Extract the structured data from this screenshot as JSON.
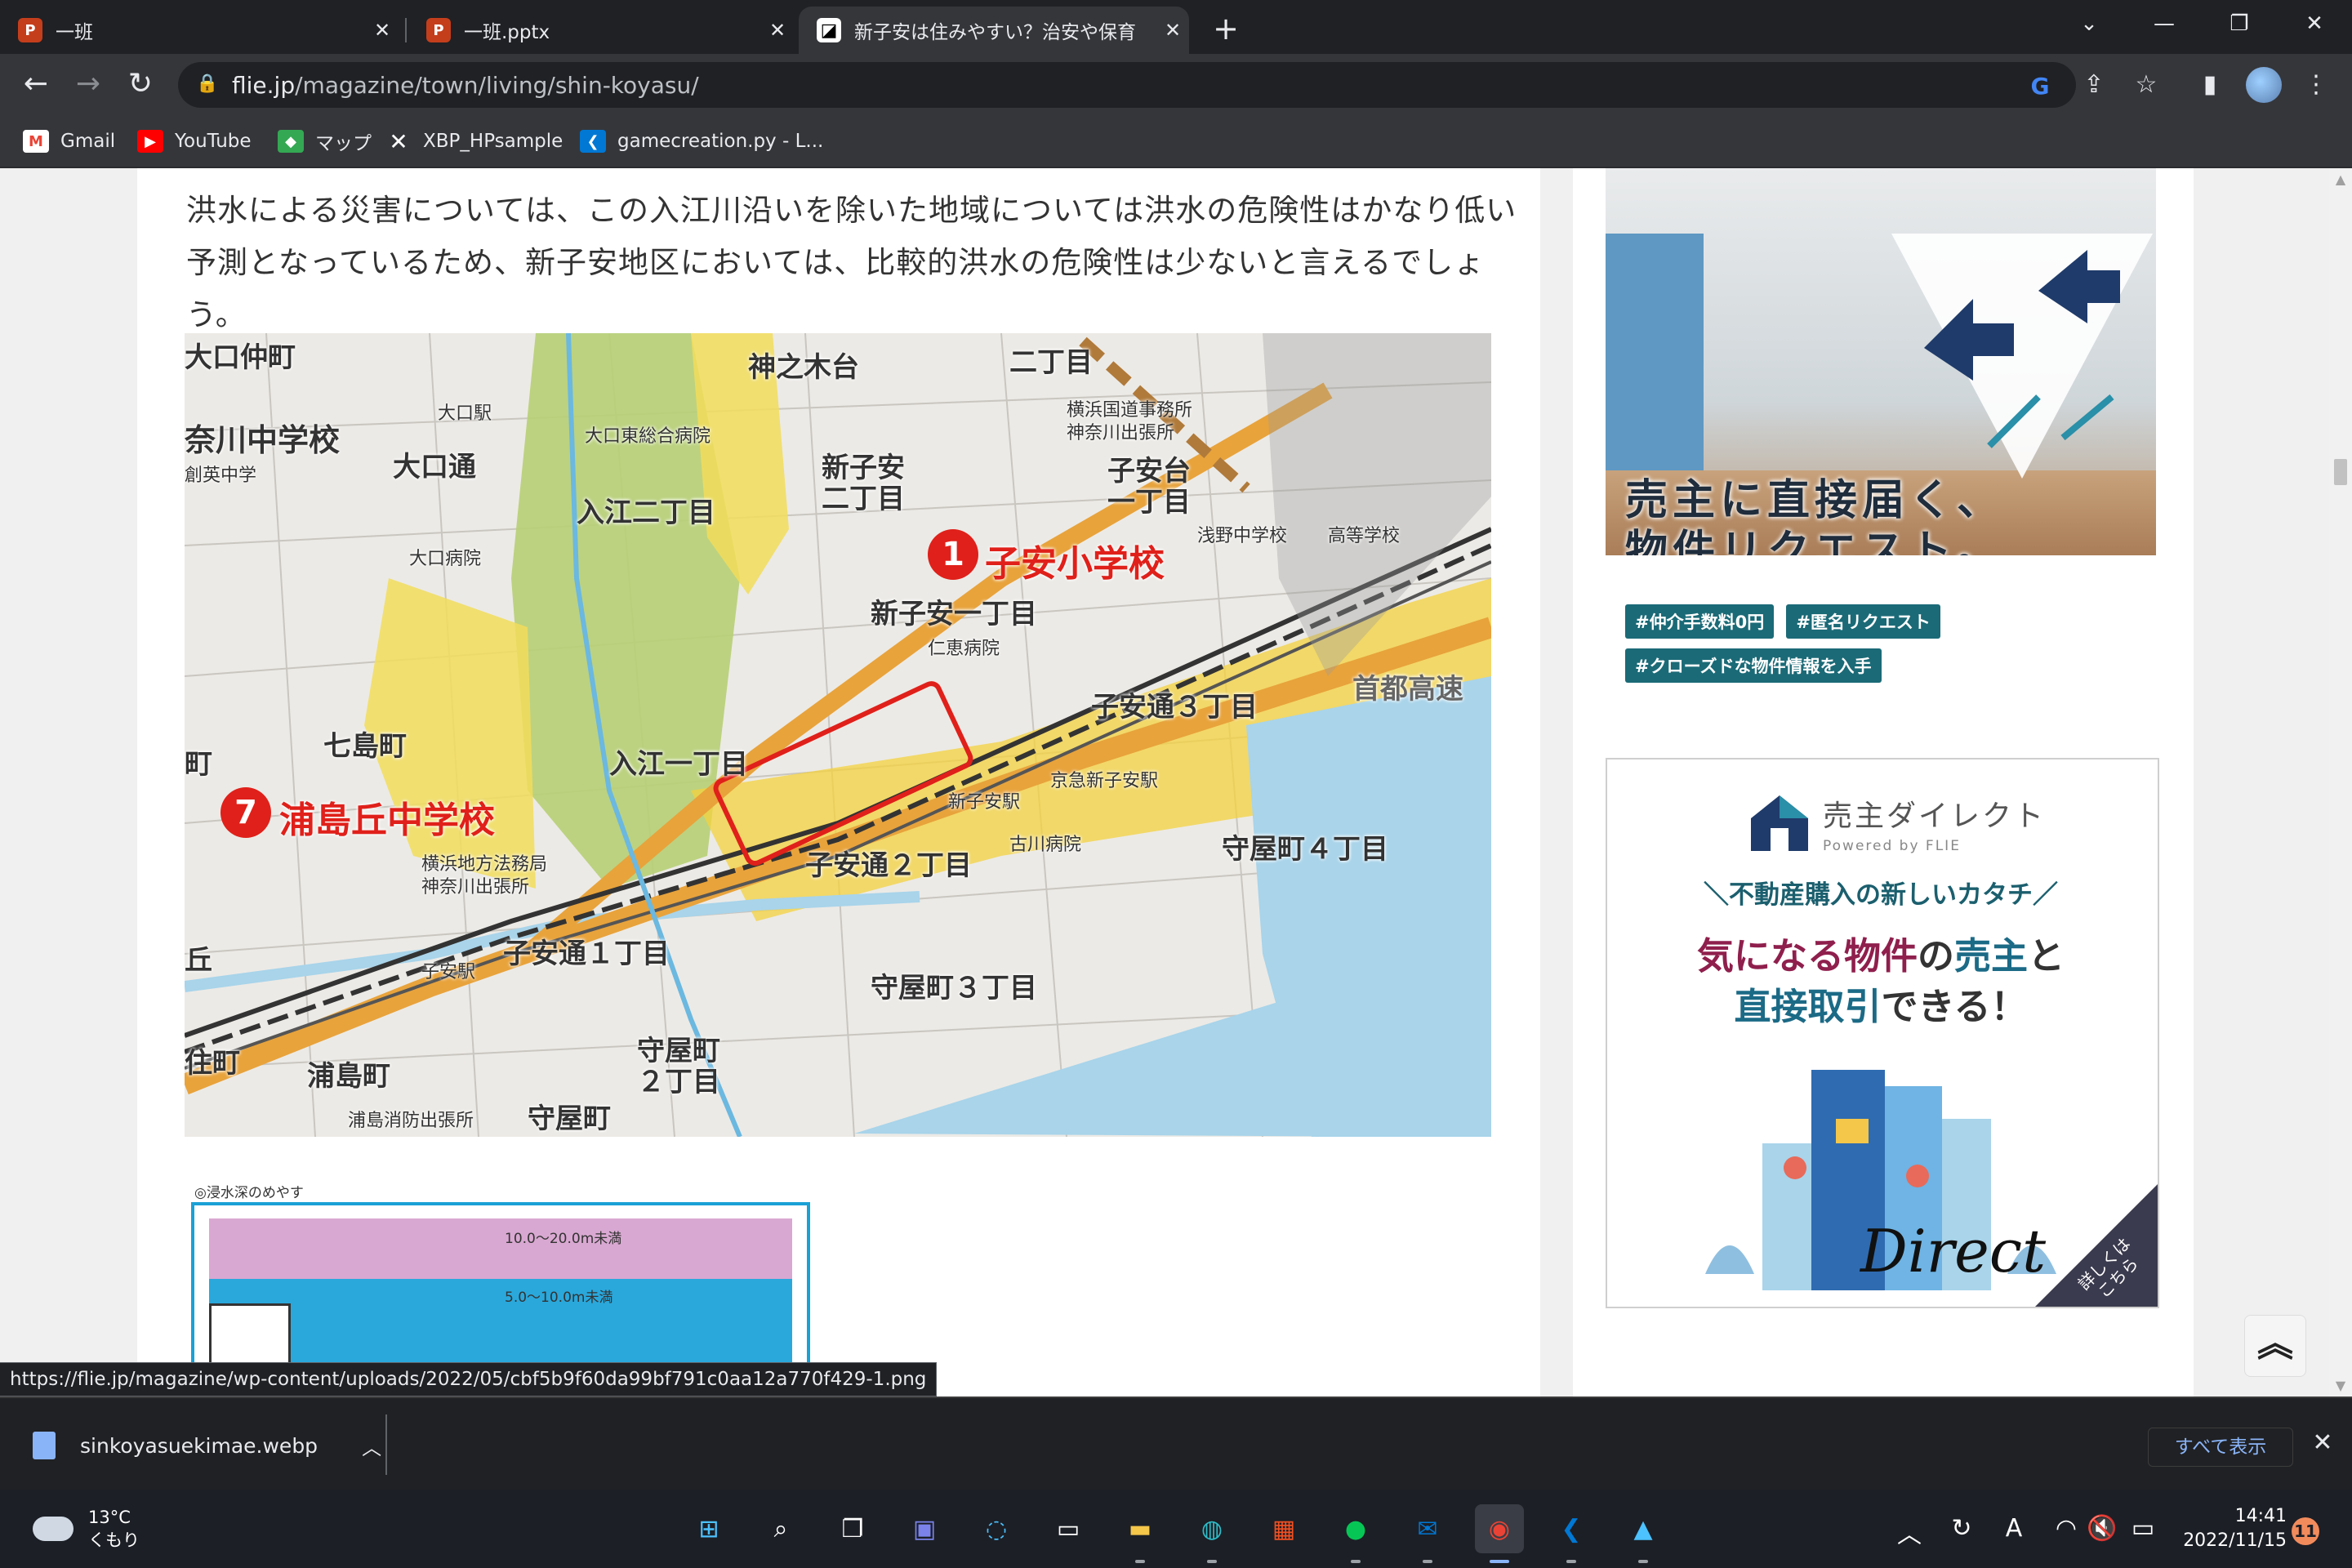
{
  "tabs": [
    {
      "title": "一班",
      "icon": "powerpoint-icon"
    },
    {
      "title": "一班.pptx",
      "icon": "powerpoint-icon"
    },
    {
      "title": "新子安は住みやすい？治安や保育",
      "icon": "flie-site-icon",
      "active": true
    }
  ],
  "omnibox": {
    "domain": "flie.jp",
    "path": "/magazine/town/living/shin-koyasu/"
  },
  "bookmarks": [
    {
      "label": "Gmail",
      "icon": "gmail-icon"
    },
    {
      "label": "YouTube",
      "icon": "youtube-icon"
    },
    {
      "label": "マップ",
      "icon": "maps-icon"
    },
    {
      "label": "XBP_HPsample",
      "icon": "x-icon"
    },
    {
      "label": "gamecreation.py - L...",
      "icon": "vscode-icon"
    }
  ],
  "article": {
    "paragraph": "洪水による災害については、この入江川沿いを除いた地域については洪水の危険性はかなり低い予測となっているため、新子安地区においては、比較的洪水の危険性は少ないと言えるでしょう。",
    "map_labels": {
      "oguchi_nakamachi": "大口仲町",
      "kaminoki": "神之木台",
      "nichome": "二丁目",
      "nagawa_school": "奈川中学校",
      "oguchi_station": "大口駅",
      "oguchi_dori": "大口通",
      "oguchi_hospital_east": "大口東総合病院",
      "soei": "創英中学",
      "irie_2": "入江二丁目",
      "shinkoyasu_2": "新子安二丁目",
      "koyasudai_1": "子安台一丁目",
      "kokudo_office": "横浜国道事務所",
      "kanagawa_branch": "神奈川出張所",
      "oguchi_hospital": "大口病院",
      "koyasu_school": "子安小学校",
      "koyasu_school_num": "1",
      "shinkoyasu_1": "新子安一丁目",
      "jinkei_hospital": "仁恵病院",
      "asano_school": "浅野中学校",
      "high_school": "高等学校",
      "shutoko": "首都高速",
      "shichishima": "七島町",
      "koyasudori_3": "子安通３丁目",
      "irie_1": "入江一丁目",
      "urashimaoka_school": "浦島丘中学校",
      "urashimaoka_num": "7",
      "keikyu_shinkoyasu": "京急新子安駅",
      "shinkoyasu_station": "新子安駅",
      "court": "横浜地方法務局",
      "court_branch": "神奈川出張所",
      "koyasudori_2": "子安通２丁目",
      "furukawa_hospital": "古川病院",
      "moriyacho_4": "守屋町４丁目",
      "koyasudori_1": "子安通１丁目",
      "koyasu_station": "子安駅",
      "moriyacho_3": "守屋町３丁目",
      "sumiyoshi": "住町",
      "urashimacho": "浦島町",
      "moriyacho_2": "守屋町２丁目",
      "fire_station": "浦島消防出張所",
      "moriyacho": "守屋町",
      "oka": "丘",
      "cho": "町"
    },
    "legend": {
      "caption": "◎浸水深のめやす",
      "band1": "10.0〜20.0m未満",
      "band2": "5.0〜10.0m未満"
    }
  },
  "sidebar": {
    "ad1": {
      "line1": "売主に直接届く、",
      "line2": "物件リクエスト。",
      "tags": [
        "#仲介手数料0円",
        "#匿名リクエスト",
        "#クローズドな物件情報を入手"
      ]
    },
    "ad2": {
      "brand": "売主ダイレクト",
      "powered": "Powered by FLIE",
      "tagline": "＼不動産購入の新しいカタチ／",
      "line1_a": "気になる物件",
      "line1_b": "の",
      "line1_c": "売主",
      "line1_d": "と",
      "line2_a": "直接取引",
      "line2_b": "できる！",
      "logo_text": "Direct",
      "corner": "詳しくはこちら"
    }
  },
  "status_url": "https://flie.jp/magazine/wp-content/uploads/2022/05/cbf5b9f60da99bf791c0aa12a770f429-1.png",
  "download": {
    "filename": "sinkoyasuekimae.webp",
    "show_all": "すべて表示"
  },
  "taskbar": {
    "temp": "13°C",
    "weather": "くもり",
    "time": "14:41",
    "date": "2022/11/15",
    "notifications": "11"
  },
  "colors": {
    "map_red": "#e0201a",
    "tag_teal": "#1b6a77",
    "link_blue": "#8ab4f8"
  }
}
